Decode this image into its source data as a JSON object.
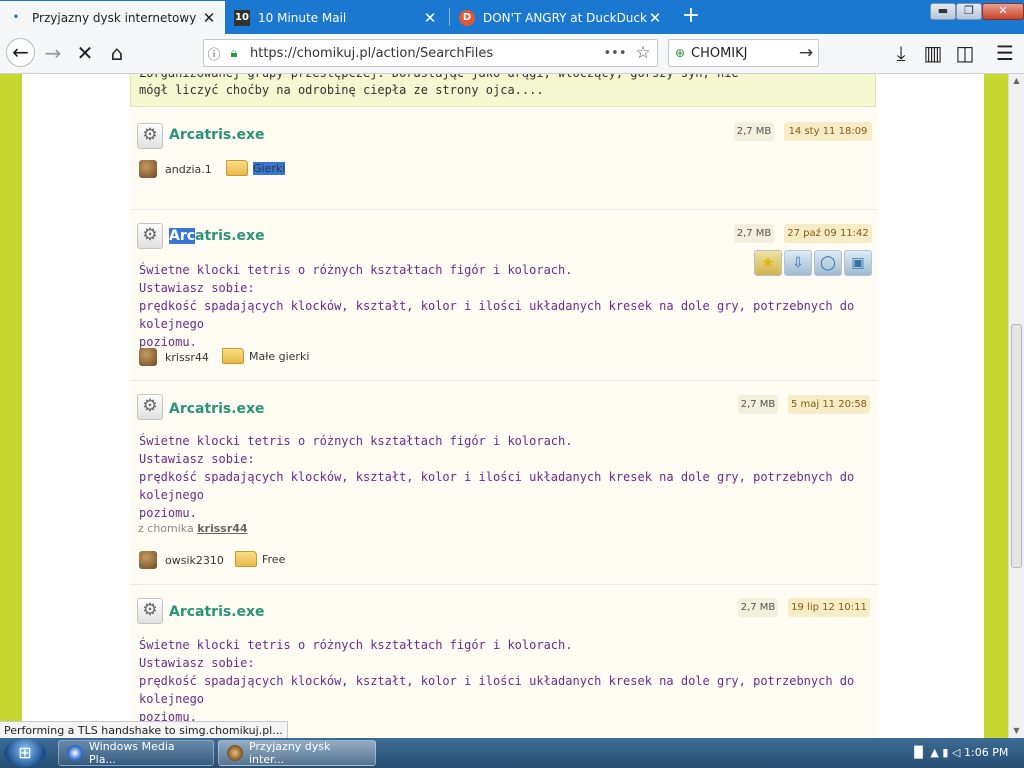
{
  "browser": {
    "tabs": [
      {
        "title": "Przyjazny dysk internetowy - Chomikuj.pl",
        "icon": "chomikuj-favicon",
        "active": true
      },
      {
        "title": "10 Minute Mail",
        "icon": "10minutemail-favicon",
        "active": false
      },
      {
        "title": "DON'T ANGRY at DuckDuckGo",
        "icon": "duckduckgo-favicon",
        "active": false
      }
    ],
    "new_tab": "+",
    "window_controls": {
      "minimize": "▬",
      "maximize": "❐",
      "close": "✕"
    },
    "nav": {
      "back": "←",
      "forward": "→",
      "stop": "✕",
      "home": "⌂"
    },
    "url": "https://chomikuj.pl/action/SearchFiles",
    "url_more": "•••",
    "bookmark_star": "☆",
    "search_engine_text": "CHOMIKJ",
    "search_go": "→",
    "toolbar_icons": {
      "downloads": "⤓",
      "library": "▥",
      "sidebar": "◫",
      "menu": "☰"
    }
  },
  "page": {
    "top_description": [
      "Zorganizowanej grupy przestępczej. Dorastając jako drągi, włóczący, gorszy syn, nie",
      "mógł liczyć choćby na odrobinę ciepła ze strony ojca...."
    ],
    "files": [
      {
        "name": "Arcatris.exe",
        "size": "2,7 MB",
        "date": "14 sty 11 18:09",
        "owner": "andzia.1",
        "folder": "Gierki",
        "description": []
      },
      {
        "name_highlight": "Arc",
        "name_rest": "atris.exe",
        "size": "2,7 MB",
        "date": "27 paź 09 11:42",
        "owner": "krissr44",
        "folder": "Małe gierki",
        "description": [
          "Świetne klocki tetris o różnych kształtach figór i kolorach.",
          "Ustawiasz sobie:",
          "prędkość spadających klocków, kształt, kolor i ilości układanych kresek na dole gry, potrzebnych do kolejnego",
          "poziomu."
        ],
        "actions": [
          {
            "name": "star-icon",
            "glyph": "★"
          },
          {
            "name": "download-icon",
            "glyph": "⇩"
          },
          {
            "name": "comment-icon",
            "glyph": "◯"
          },
          {
            "name": "copy-icon",
            "glyph": "▣"
          }
        ]
      },
      {
        "name": "Arcatris.exe",
        "size": "2,7 MB",
        "date": "5 maj 11 20:58",
        "owner": "owsik2310",
        "folder": "Free",
        "from_label": "z chomika",
        "from_user": "krissr44",
        "description": [
          "Świetne klocki tetris o różnych kształtach figór i kolorach.",
          "Ustawiasz sobie:",
          "prędkość spadających klocków, kształt, kolor i ilości układanych kresek na dole gry, potrzebnych do kolejnego",
          "poziomu."
        ]
      },
      {
        "name": "Arcatris.exe",
        "size": "2,7 MB",
        "date": "19 lip 12 10:11",
        "description": [
          "Świetne klocki tetris o różnych kształtach figór i kolorach.",
          "Ustawiasz sobie:",
          "prędkość spadających klocków, kształt, kolor i ilości układanych kresek na dole gry, potrzebnych do kolejnego",
          "poziomu."
        ]
      }
    ]
  },
  "status_text": "Performing a TLS handshake to simg.chomikuj.pl...",
  "taskbar": {
    "start": "⊞",
    "buttons": [
      {
        "label": "Windows Media Pla...",
        "active": false
      },
      {
        "label": "Przyjazny dysk inter...",
        "active": true
      }
    ],
    "tray": "▐▌ ▲ ▮ ◁",
    "clock": "1:06 PM"
  },
  "colors": {
    "page_border": "#c4d52e",
    "file_title": "#2a9478",
    "description_text": "#6a2a8e",
    "selection": "#3875d7",
    "tab_strip": "#1b78d0"
  }
}
